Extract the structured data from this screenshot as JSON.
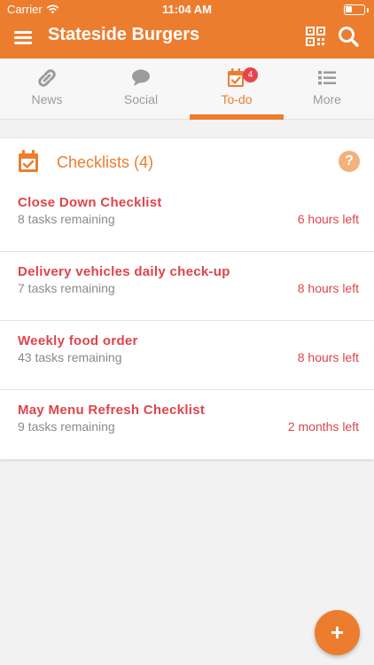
{
  "status_bar": {
    "carrier": "Carrier",
    "time": "11:04 AM"
  },
  "app": {
    "title": "Stateside Burgers",
    "accent": "#ec7d2f",
    "icons": {
      "menu": "hamburger-menu-icon",
      "qr": "qr-code-icon",
      "search": "search-icon"
    }
  },
  "tabs": [
    {
      "label": "News",
      "icon": "link-icon",
      "active": false
    },
    {
      "label": "Social",
      "icon": "chat-bubble-icon",
      "active": false
    },
    {
      "label": "To-do",
      "icon": "calendar-check-icon",
      "active": true,
      "badge": "4"
    },
    {
      "label": "More",
      "icon": "list-icon",
      "active": false
    }
  ],
  "checklists": {
    "title": "Checklists (4)",
    "help_label": "?",
    "items": [
      {
        "name": "Close Down Checklist",
        "remaining": "8 tasks remaining",
        "due": "6 hours left"
      },
      {
        "name": "Delivery vehicles daily check-up",
        "remaining": "7 tasks remaining",
        "due": "8 hours left"
      },
      {
        "name": "Weekly food order",
        "remaining": "43 tasks remaining",
        "due": "8 hours left"
      },
      {
        "name": "May Menu Refresh Checklist",
        "remaining": "9 tasks remaining",
        "due": "2 months left"
      }
    ]
  },
  "fab": {
    "label": "+"
  }
}
